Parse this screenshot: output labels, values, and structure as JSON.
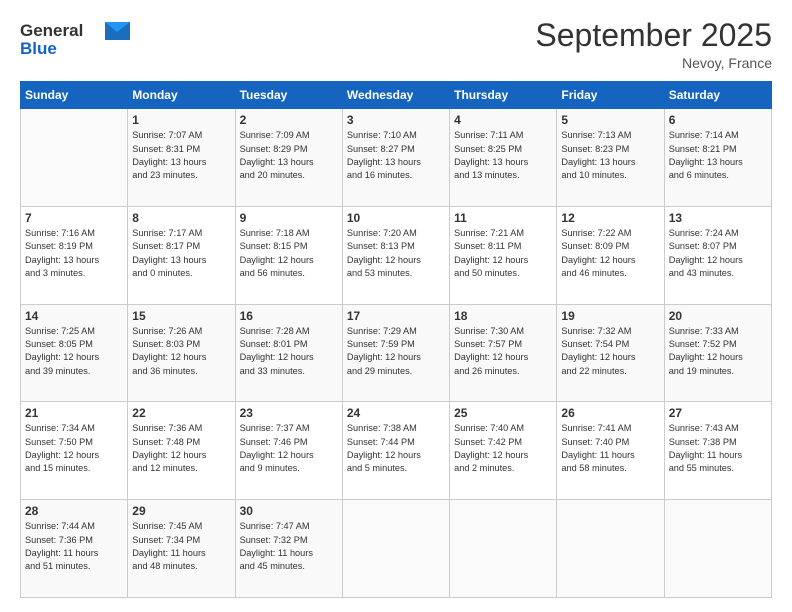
{
  "logo": {
    "general": "General",
    "blue": "Blue"
  },
  "header": {
    "month": "September 2025",
    "location": "Nevoy, France"
  },
  "weekdays": [
    "Sunday",
    "Monday",
    "Tuesday",
    "Wednesday",
    "Thursday",
    "Friday",
    "Saturday"
  ],
  "weeks": [
    [
      {
        "day": "",
        "info": ""
      },
      {
        "day": "1",
        "info": "Sunrise: 7:07 AM\nSunset: 8:31 PM\nDaylight: 13 hours\nand 23 minutes."
      },
      {
        "day": "2",
        "info": "Sunrise: 7:09 AM\nSunset: 8:29 PM\nDaylight: 13 hours\nand 20 minutes."
      },
      {
        "day": "3",
        "info": "Sunrise: 7:10 AM\nSunset: 8:27 PM\nDaylight: 13 hours\nand 16 minutes."
      },
      {
        "day": "4",
        "info": "Sunrise: 7:11 AM\nSunset: 8:25 PM\nDaylight: 13 hours\nand 13 minutes."
      },
      {
        "day": "5",
        "info": "Sunrise: 7:13 AM\nSunset: 8:23 PM\nDaylight: 13 hours\nand 10 minutes."
      },
      {
        "day": "6",
        "info": "Sunrise: 7:14 AM\nSunset: 8:21 PM\nDaylight: 13 hours\nand 6 minutes."
      }
    ],
    [
      {
        "day": "7",
        "info": "Sunrise: 7:16 AM\nSunset: 8:19 PM\nDaylight: 13 hours\nand 3 minutes."
      },
      {
        "day": "8",
        "info": "Sunrise: 7:17 AM\nSunset: 8:17 PM\nDaylight: 13 hours\nand 0 minutes."
      },
      {
        "day": "9",
        "info": "Sunrise: 7:18 AM\nSunset: 8:15 PM\nDaylight: 12 hours\nand 56 minutes."
      },
      {
        "day": "10",
        "info": "Sunrise: 7:20 AM\nSunset: 8:13 PM\nDaylight: 12 hours\nand 53 minutes."
      },
      {
        "day": "11",
        "info": "Sunrise: 7:21 AM\nSunset: 8:11 PM\nDaylight: 12 hours\nand 50 minutes."
      },
      {
        "day": "12",
        "info": "Sunrise: 7:22 AM\nSunset: 8:09 PM\nDaylight: 12 hours\nand 46 minutes."
      },
      {
        "day": "13",
        "info": "Sunrise: 7:24 AM\nSunset: 8:07 PM\nDaylight: 12 hours\nand 43 minutes."
      }
    ],
    [
      {
        "day": "14",
        "info": "Sunrise: 7:25 AM\nSunset: 8:05 PM\nDaylight: 12 hours\nand 39 minutes."
      },
      {
        "day": "15",
        "info": "Sunrise: 7:26 AM\nSunset: 8:03 PM\nDaylight: 12 hours\nand 36 minutes."
      },
      {
        "day": "16",
        "info": "Sunrise: 7:28 AM\nSunset: 8:01 PM\nDaylight: 12 hours\nand 33 minutes."
      },
      {
        "day": "17",
        "info": "Sunrise: 7:29 AM\nSunset: 7:59 PM\nDaylight: 12 hours\nand 29 minutes."
      },
      {
        "day": "18",
        "info": "Sunrise: 7:30 AM\nSunset: 7:57 PM\nDaylight: 12 hours\nand 26 minutes."
      },
      {
        "day": "19",
        "info": "Sunrise: 7:32 AM\nSunset: 7:54 PM\nDaylight: 12 hours\nand 22 minutes."
      },
      {
        "day": "20",
        "info": "Sunrise: 7:33 AM\nSunset: 7:52 PM\nDaylight: 12 hours\nand 19 minutes."
      }
    ],
    [
      {
        "day": "21",
        "info": "Sunrise: 7:34 AM\nSunset: 7:50 PM\nDaylight: 12 hours\nand 15 minutes."
      },
      {
        "day": "22",
        "info": "Sunrise: 7:36 AM\nSunset: 7:48 PM\nDaylight: 12 hours\nand 12 minutes."
      },
      {
        "day": "23",
        "info": "Sunrise: 7:37 AM\nSunset: 7:46 PM\nDaylight: 12 hours\nand 9 minutes."
      },
      {
        "day": "24",
        "info": "Sunrise: 7:38 AM\nSunset: 7:44 PM\nDaylight: 12 hours\nand 5 minutes."
      },
      {
        "day": "25",
        "info": "Sunrise: 7:40 AM\nSunset: 7:42 PM\nDaylight: 12 hours\nand 2 minutes."
      },
      {
        "day": "26",
        "info": "Sunrise: 7:41 AM\nSunset: 7:40 PM\nDaylight: 11 hours\nand 58 minutes."
      },
      {
        "day": "27",
        "info": "Sunrise: 7:43 AM\nSunset: 7:38 PM\nDaylight: 11 hours\nand 55 minutes."
      }
    ],
    [
      {
        "day": "28",
        "info": "Sunrise: 7:44 AM\nSunset: 7:36 PM\nDaylight: 11 hours\nand 51 minutes."
      },
      {
        "day": "29",
        "info": "Sunrise: 7:45 AM\nSunset: 7:34 PM\nDaylight: 11 hours\nand 48 minutes."
      },
      {
        "day": "30",
        "info": "Sunrise: 7:47 AM\nSunset: 7:32 PM\nDaylight: 11 hours\nand 45 minutes."
      },
      {
        "day": "",
        "info": ""
      },
      {
        "day": "",
        "info": ""
      },
      {
        "day": "",
        "info": ""
      },
      {
        "day": "",
        "info": ""
      }
    ]
  ]
}
